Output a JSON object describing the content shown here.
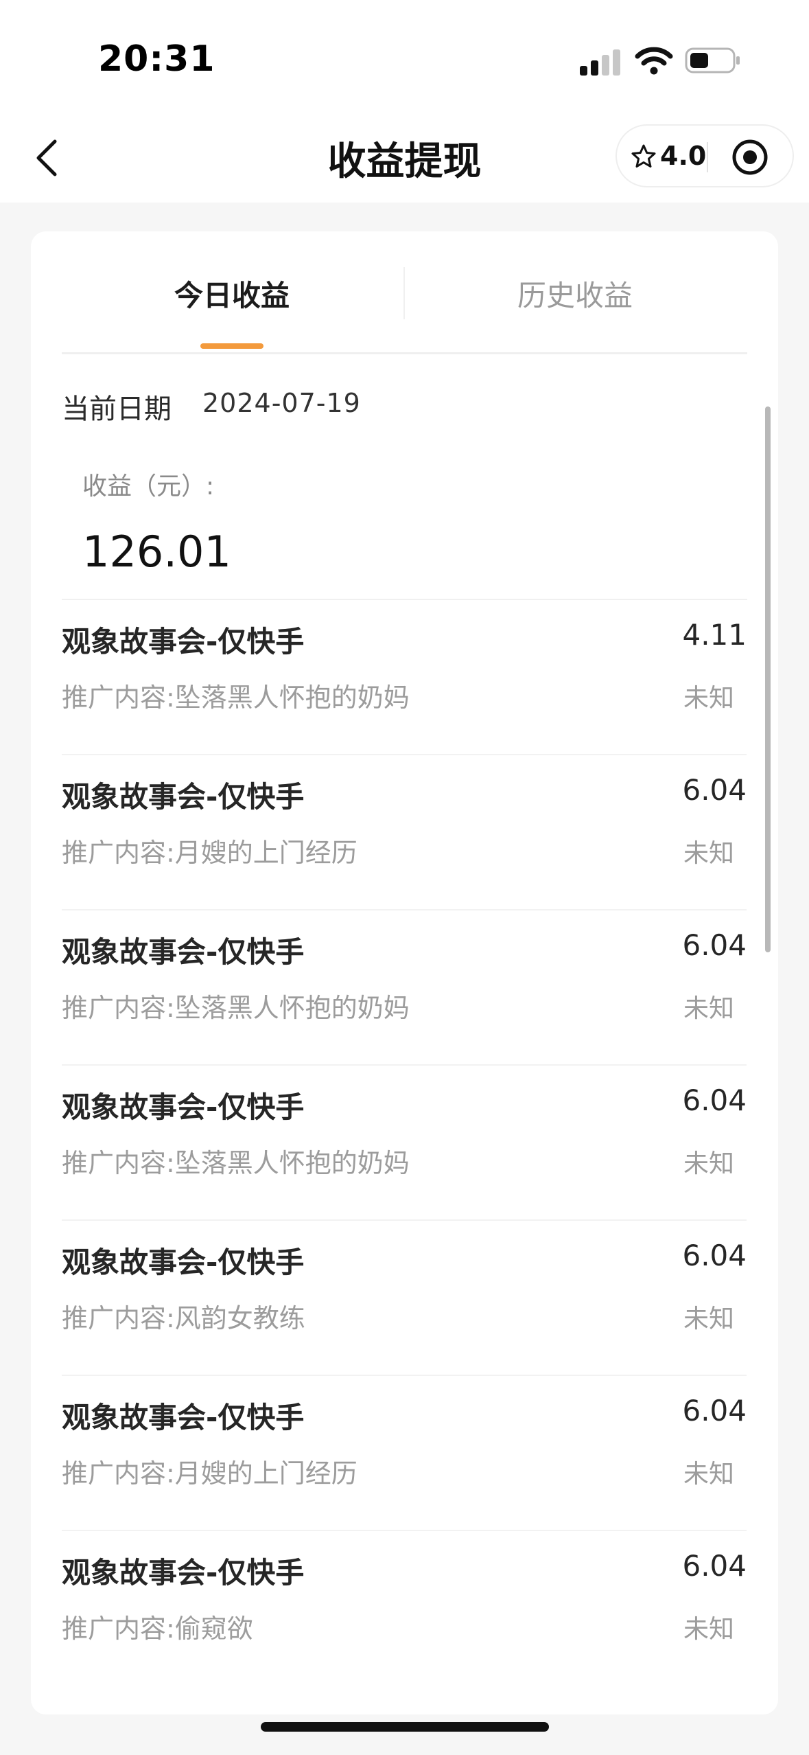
{
  "status_bar": {
    "time": "20:31"
  },
  "nav": {
    "title": "收益提现",
    "rating": "4.0"
  },
  "tabs": [
    {
      "label": "今日收益",
      "active": true
    },
    {
      "label": "历史收益",
      "active": false
    }
  ],
  "summary": {
    "date_label": "当前日期",
    "date_value": "2024-07-19",
    "earnings_label": "收益（元）:",
    "earnings_amount": "126.01"
  },
  "items": [
    {
      "title": "观象故事会-仅快手",
      "amount": "4.11",
      "subtitle": "推广内容:坠落黑人怀抱的奶妈",
      "status": "未知"
    },
    {
      "title": "观象故事会-仅快手",
      "amount": "6.04",
      "subtitle": "推广内容:月嫂的上门经历",
      "status": "未知"
    },
    {
      "title": "观象故事会-仅快手",
      "amount": "6.04",
      "subtitle": "推广内容:坠落黑人怀抱的奶妈",
      "status": "未知"
    },
    {
      "title": "观象故事会-仅快手",
      "amount": "6.04",
      "subtitle": "推广内容:坠落黑人怀抱的奶妈",
      "status": "未知"
    },
    {
      "title": "观象故事会-仅快手",
      "amount": "6.04",
      "subtitle": "推广内容:风韵女教练",
      "status": "未知"
    },
    {
      "title": "观象故事会-仅快手",
      "amount": "6.04",
      "subtitle": "推广内容:月嫂的上门经历",
      "status": "未知"
    },
    {
      "title": "观象故事会-仅快手",
      "amount": "6.04",
      "subtitle": "推广内容:偷窥欲",
      "status": "未知"
    }
  ],
  "colors": {
    "accent": "#f39a3c",
    "background": "#f6f6f6",
    "card": "#ffffff",
    "muted_text": "#9c9c9c"
  },
  "icons": {
    "back": "chevron-left-icon",
    "rating": "star-outline-icon",
    "mini_program": "target-icon"
  }
}
